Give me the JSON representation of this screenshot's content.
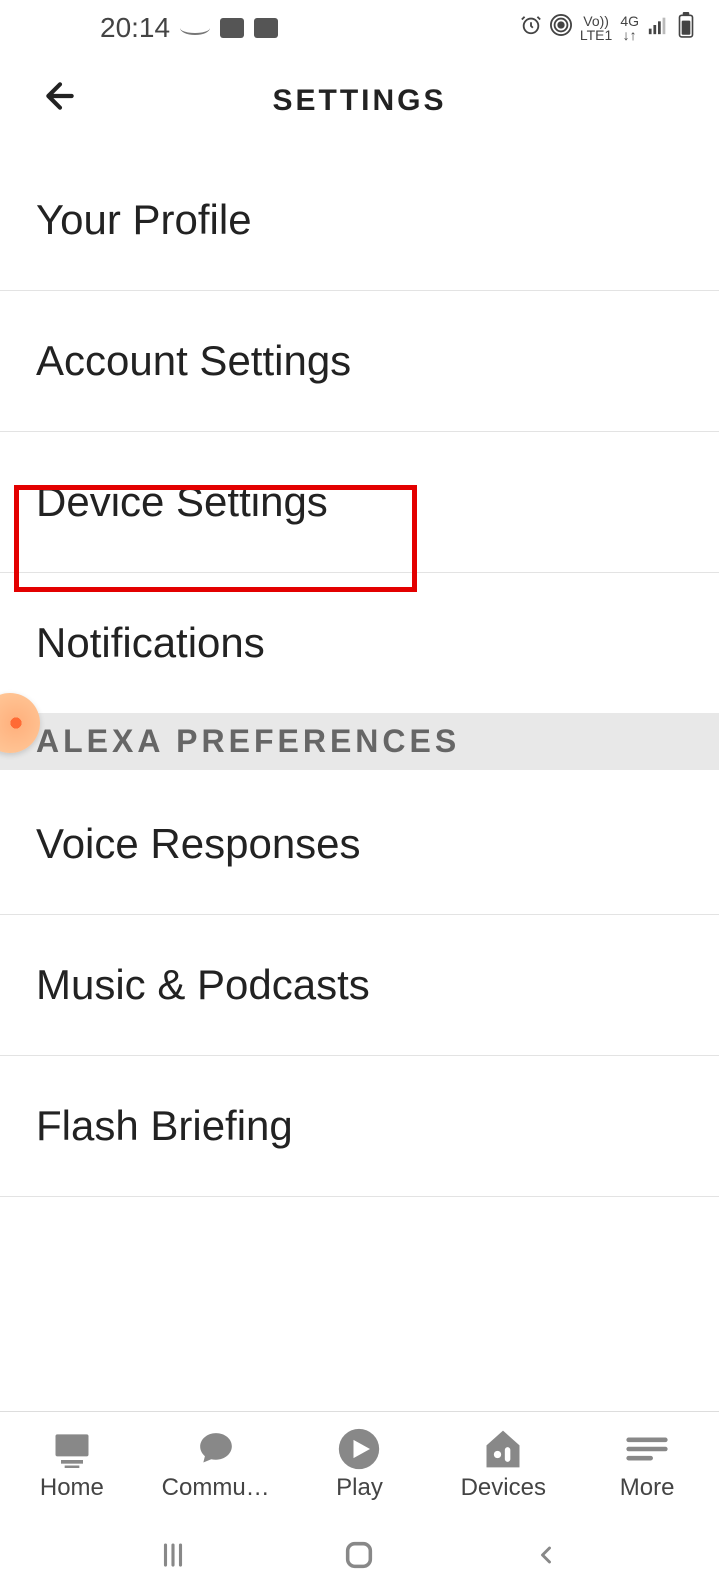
{
  "status_bar": {
    "time": "20:14",
    "network": {
      "vo": "Vo))",
      "lte": "LTE1",
      "gen": "4G",
      "arrows": "↓↑"
    }
  },
  "header": {
    "title": "SETTINGS"
  },
  "items": [
    {
      "label": "Your Profile"
    },
    {
      "label": "Account Settings"
    },
    {
      "label": "Device Settings"
    },
    {
      "label": "Notifications"
    }
  ],
  "section_header": "ALEXA PREFERENCES",
  "pref_items": [
    {
      "label": "Voice Responses"
    },
    {
      "label": "Music & Podcasts"
    },
    {
      "label": "Flash Briefing"
    }
  ],
  "bottom_nav": [
    {
      "label": "Home"
    },
    {
      "label": "Commu…"
    },
    {
      "label": "Play"
    },
    {
      "label": "Devices"
    },
    {
      "label": "More"
    }
  ]
}
